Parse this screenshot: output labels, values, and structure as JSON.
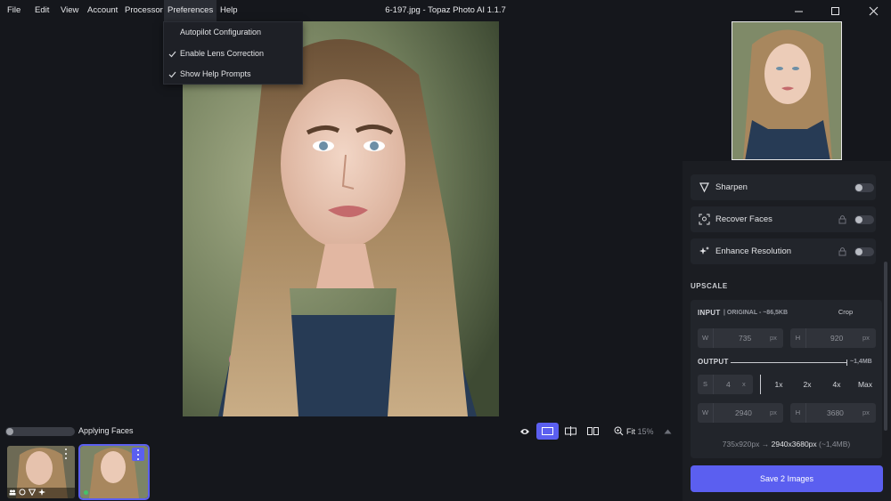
{
  "menu": {
    "items": [
      "File",
      "Edit",
      "View",
      "Account",
      "Processor",
      "Preferences",
      "Help"
    ],
    "active": "Preferences"
  },
  "window": {
    "title": "6-197.jpg - Topaz Photo AI 1.1.7"
  },
  "dropdown": {
    "items": [
      {
        "label": "Autopilot Configuration",
        "checked": false
      },
      {
        "label": "Enable Lens Correction",
        "checked": true
      },
      {
        "label": "Show Help Prompts",
        "checked": true
      }
    ]
  },
  "status": {
    "progress_label": "Applying Faces",
    "progress_fraction": 0.05
  },
  "view": {
    "zoom_label": "Fit",
    "zoom_value": "15%"
  },
  "panel": {
    "toggles": [
      {
        "label": "Sharpen",
        "icon": "sharpen-icon",
        "locked": false,
        "enabled": false
      },
      {
        "label": "Recover Faces",
        "icon": "face-scan-icon",
        "locked": true,
        "enabled": false
      },
      {
        "label": "Enhance Resolution",
        "icon": "sparkle-icon",
        "locked": true,
        "enabled": false
      }
    ],
    "upscale": {
      "title": "UPSCALE",
      "input_label": "INPUT",
      "input_info": "| ORIGINAL - ~86,5KB",
      "crop_label": "Crop",
      "input_w": "735",
      "input_h": "920",
      "w_prefix": "W",
      "h_prefix": "H",
      "unit_px": "px",
      "output_label": "OUTPUT",
      "output_size": "~1,4MB",
      "scale_prefix": "S",
      "scale_value": "4",
      "scale_unit": "x",
      "multipliers": [
        "1x",
        "2x",
        "4x",
        "Max"
      ],
      "output_w": "2940",
      "output_h": "3680",
      "summary_from": "735x920px",
      "summary_arrow": "→",
      "summary_to": "2940x3680px",
      "summary_size": "(~1,4MB)"
    },
    "save_label": "Save 2 Images"
  },
  "colors": {
    "accent": "#5b5ff0",
    "background": "#15171c",
    "panel": "#1b1d22"
  }
}
